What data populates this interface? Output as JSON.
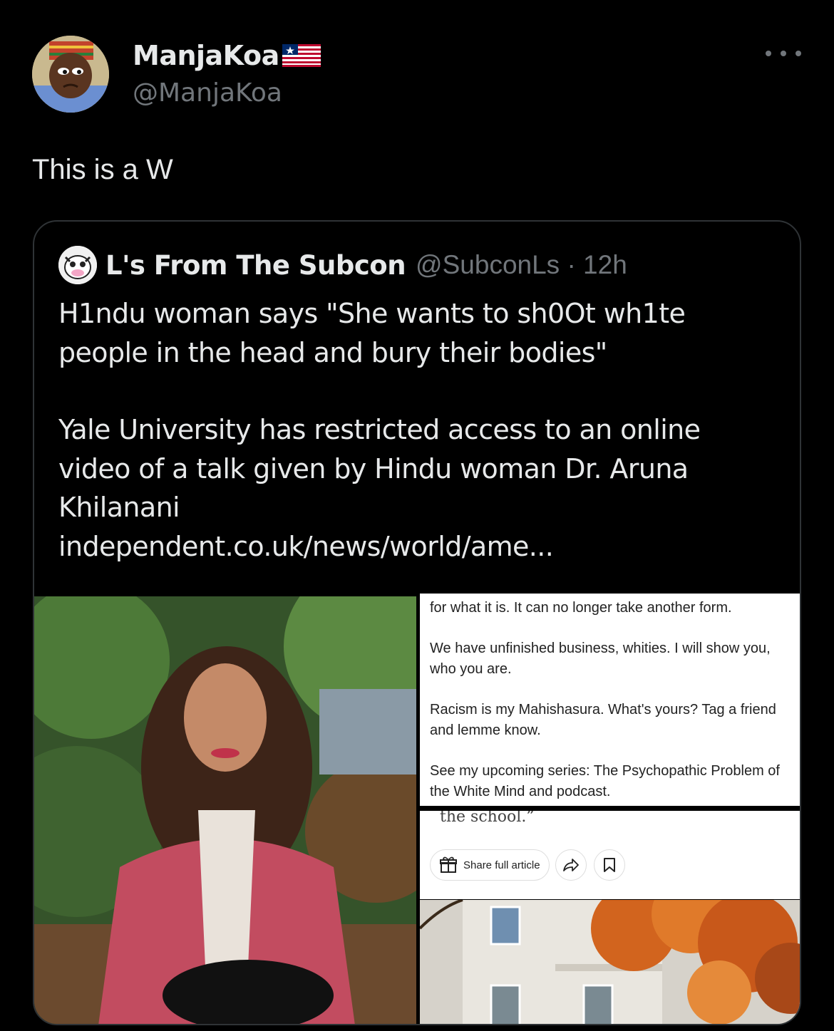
{
  "author": {
    "name": "ManjaKoa",
    "handle": "@ManjaKoa"
  },
  "tweet": {
    "text": "This is a W"
  },
  "quoted": {
    "name": "L's From The Subcon",
    "handle_time": "@SubconLs · 12h",
    "paragraph1": "H1ndu woman says \"She wants to sh0Ot wh1te\npeople in the head and bury their bodies\"",
    "paragraph2": "Yale University has restricted access to an online\nvideo of a talk given by Hindu woman Dr. Aruna\nKhilanani",
    "link": "independent.co.uk/news/world/ame..."
  },
  "media": {
    "panel_lines": [
      "for what it is. It can no longer take another form.",
      "We have unfinished business, whities. I will show you, who you are.",
      "Racism is my Mahishasura. What's yours? Tag a friend and lemme know.",
      "See my upcoming series: The Psychopathic Problem of the White Mind and podcast."
    ],
    "article_snippet": "the school.”",
    "share_label": "Share full article"
  },
  "icons": {
    "more": "more-icon",
    "flag": "liberia-flag-icon",
    "gift": "gift-icon",
    "share": "share-arrow-icon",
    "bookmark": "bookmark-icon"
  }
}
